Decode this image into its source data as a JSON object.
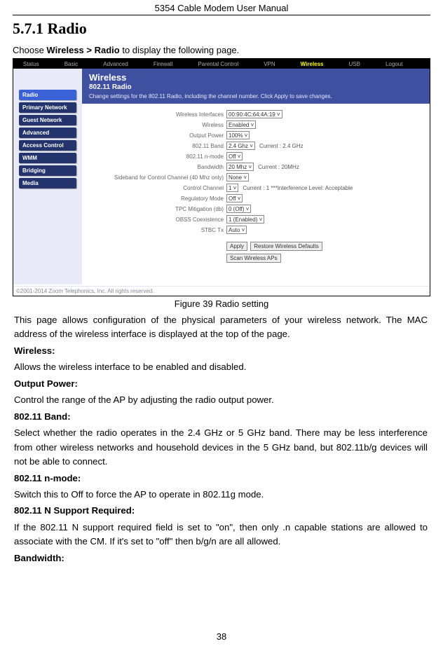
{
  "header": {
    "title": "5354 Cable Modem User Manual"
  },
  "section": {
    "number": "5.7.1",
    "name": "Radio",
    "full": "5.7.1   Radio"
  },
  "instruction": {
    "prefix": "Choose ",
    "bold": "Wireless > Radio",
    "suffix": " to display the following page."
  },
  "screenshot": {
    "tabs": {
      "status": "Status",
      "basic": "Basic",
      "advanced": "Advanced",
      "firewall": "Firewall",
      "parental": "Parental Control",
      "vpn": "VPN",
      "wireless": "Wireless",
      "usb": "USB",
      "logout": "Logout"
    },
    "sidebar": {
      "radio": "Radio",
      "primary": "Primary Network",
      "guest": "Guest Network",
      "advanced": "Advanced",
      "access": "Access Control",
      "wmm": "WMM",
      "bridging": "Bridging",
      "media": "Media"
    },
    "head": {
      "h1": "Wireless",
      "h2": "802.11 Radio",
      "h3": "Change settings for the 802.11 Radio, including the channel number. Click Apply to save changes."
    },
    "form": {
      "interfaces": {
        "label": "Wireless Interfaces",
        "value": "00:90:4C:64:4A:19 ˅"
      },
      "wireless": {
        "label": "Wireless",
        "value": "Enabled ˅"
      },
      "output": {
        "label": "Output Power",
        "value": "100% ˅"
      },
      "band": {
        "label": "802.11 Band",
        "value": "2.4 Ghz ˅",
        "right": "Current :   2.4 GHz"
      },
      "nmode": {
        "label": "802.11 n-mode",
        "value": "Off  ˅"
      },
      "bandwidth": {
        "label": "Bandwidth",
        "value": "20 Mhz ˅",
        "right": "Current :   20MHz"
      },
      "sideband": {
        "label": "Sideband for Control Channel (40 Mhz only)",
        "value": "None  ˅"
      },
      "control": {
        "label": "Control Channel",
        "value": "1      ˅",
        "right": "Current :  1 ***Interference Level: Acceptable"
      },
      "regulatory": {
        "label": "Regulatory Mode",
        "value": "Off      ˅"
      },
      "tpc": {
        "label": "TPC Mitigation (db)",
        "value": "0 (Off) ˅"
      },
      "obss": {
        "label": "OBSS Coexistence",
        "value": "1 (Enabled) ˅"
      },
      "stbc": {
        "label": "STBC Tx",
        "value": "Auto ˅"
      },
      "buttons": {
        "apply": "Apply",
        "restore": "Restore Wireless Defaults",
        "scan": "Scan Wireless APs"
      }
    },
    "footer": "©2001-2014 Zoom Telephonics, Inc.  All rights reserved."
  },
  "caption": "Figure 39 Radio setting",
  "body": {
    "p1": "This page allows configuration of the physical parameters of your wireless network. The MAC address of the wireless interface is displayed at the top of the page.",
    "h_wireless": "Wireless:",
    "p_wireless": "Allows the wireless interface to be enabled and disabled.",
    "h_output": "Output Power:",
    "p_output": "Control the range of the AP by adjusting the radio output power.",
    "h_band": "802.11 Band:",
    "p_band": "Select whether the radio operates in the 2.4 GHz or 5 GHz band. There may be less interference from other wireless networks and household devices in the 5 GHz band, but 802.11b/g devices will not be able to connect.",
    "h_nmode": "802.11 n-mode:",
    "p_nmode": "Switch this to Off to force the AP to operate in 802.11g mode.",
    "h_nsupport": "802.11 N Support Required:",
    "p_nsupport": "If the 802.11 N support required field is set to \"on\", then only .n capable stations are allowed to associate with the CM.    If it's set to \"off\" then b/g/n are all allowed.",
    "h_bandwidth": "Bandwidth:"
  },
  "page_number": "38"
}
